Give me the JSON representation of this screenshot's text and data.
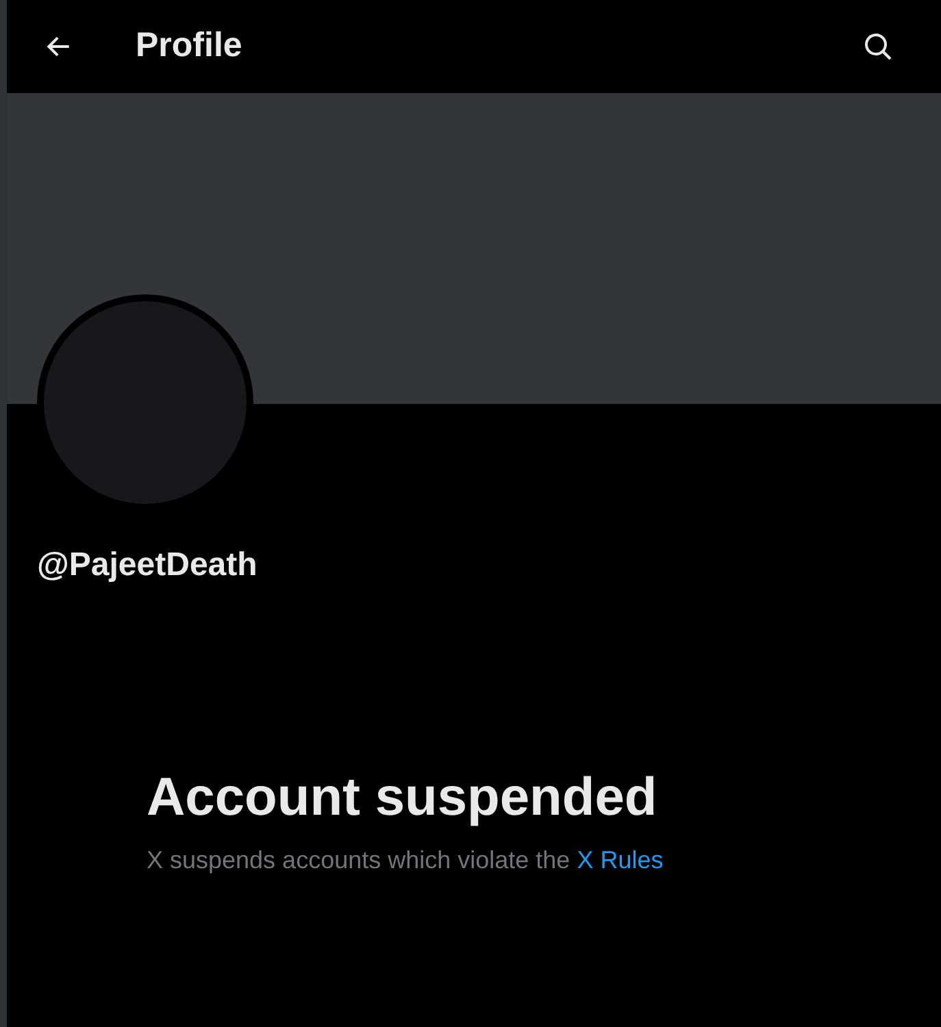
{
  "header": {
    "title": "Profile"
  },
  "profile": {
    "handle": "@PajeetDeath"
  },
  "notice": {
    "title": "Account suspended",
    "text": "X suspends accounts which violate the",
    "link": "X Rules"
  }
}
